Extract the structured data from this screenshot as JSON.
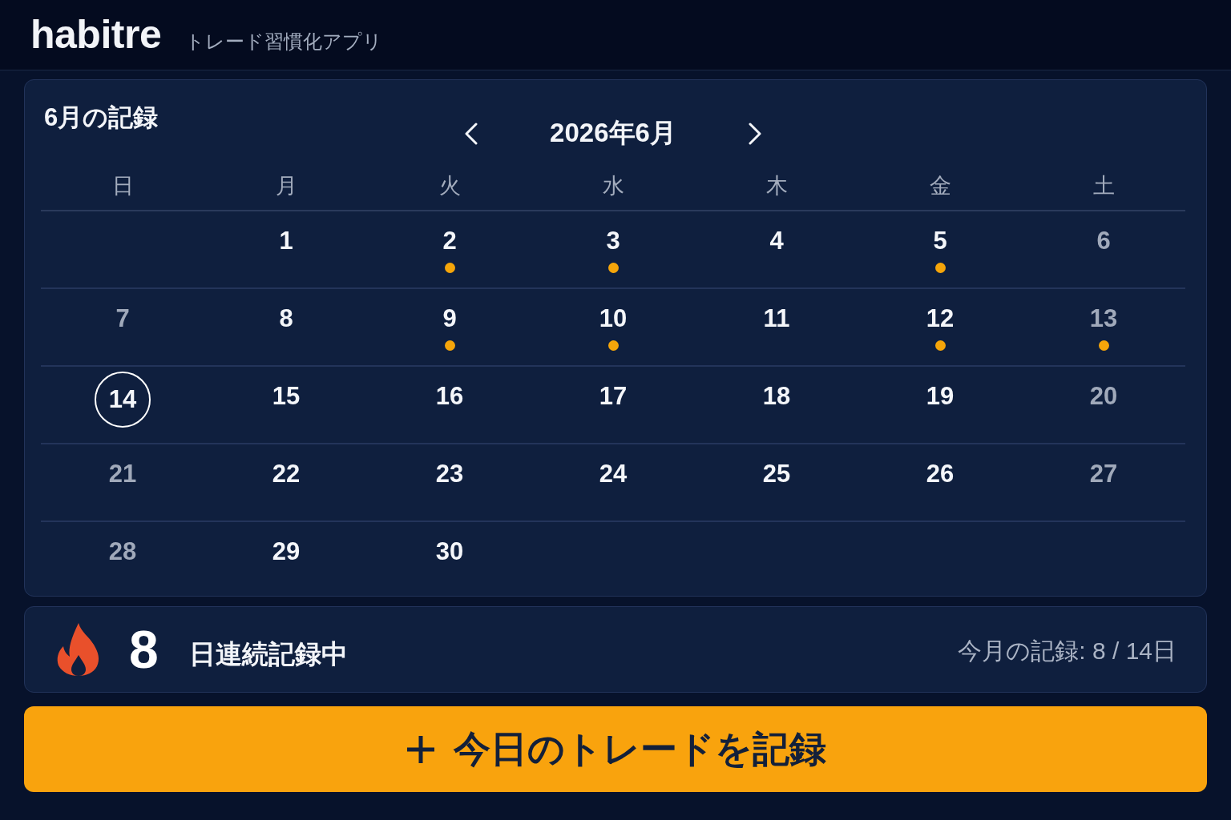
{
  "header": {
    "app_name": "habitre",
    "tagline": "トレード習慣化アプリ"
  },
  "calendar": {
    "title": "6月の記録",
    "month_label": "2026年6月",
    "weekdays": [
      "日",
      "月",
      "火",
      "水",
      "木",
      "金",
      "土"
    ],
    "weeks": [
      {
        "days": [
          {
            "kind": "blank"
          },
          {
            "kind": "day",
            "label": "1",
            "weekend": false,
            "recorded": false,
            "selected": false
          },
          {
            "kind": "day",
            "label": "2",
            "weekend": false,
            "recorded": true,
            "selected": false
          },
          {
            "kind": "day",
            "label": "3",
            "weekend": false,
            "recorded": true,
            "selected": false
          },
          {
            "kind": "day",
            "label": "4",
            "weekend": false,
            "recorded": false,
            "selected": false
          },
          {
            "kind": "day",
            "label": "5",
            "weekend": false,
            "recorded": true,
            "selected": false
          },
          {
            "kind": "day",
            "label": "6",
            "weekend": true,
            "recorded": false,
            "selected": false
          }
        ]
      },
      {
        "days": [
          {
            "kind": "day",
            "label": "7",
            "weekend": true,
            "recorded": false,
            "selected": false
          },
          {
            "kind": "day",
            "label": "8",
            "weekend": false,
            "recorded": false,
            "selected": false
          },
          {
            "kind": "day",
            "label": "9",
            "weekend": false,
            "recorded": true,
            "selected": false
          },
          {
            "kind": "day",
            "label": "10",
            "weekend": false,
            "recorded": true,
            "selected": false
          },
          {
            "kind": "day",
            "label": "11",
            "weekend": false,
            "recorded": false,
            "selected": false
          },
          {
            "kind": "day",
            "label": "12",
            "weekend": false,
            "recorded": true,
            "selected": false
          },
          {
            "kind": "day",
            "label": "13",
            "weekend": true,
            "recorded": true,
            "selected": false
          }
        ]
      },
      {
        "days": [
          {
            "kind": "day",
            "label": "14",
            "weekend": true,
            "recorded": false,
            "selected": true
          },
          {
            "kind": "day",
            "label": "15",
            "weekend": false,
            "recorded": false,
            "selected": false
          },
          {
            "kind": "day",
            "label": "16",
            "weekend": false,
            "recorded": false,
            "selected": false
          },
          {
            "kind": "day",
            "label": "17",
            "weekend": false,
            "recorded": false,
            "selected": false
          },
          {
            "kind": "day",
            "label": "18",
            "weekend": false,
            "recorded": false,
            "selected": false
          },
          {
            "kind": "day",
            "label": "19",
            "weekend": false,
            "recorded": false,
            "selected": false
          },
          {
            "kind": "day",
            "label": "20",
            "weekend": true,
            "recorded": false,
            "selected": false
          }
        ]
      },
      {
        "days": [
          {
            "kind": "day",
            "label": "21",
            "weekend": true,
            "recorded": false,
            "selected": false
          },
          {
            "kind": "day",
            "label": "22",
            "weekend": false,
            "recorded": false,
            "selected": false
          },
          {
            "kind": "day",
            "label": "23",
            "weekend": false,
            "recorded": false,
            "selected": false
          },
          {
            "kind": "day",
            "label": "24",
            "weekend": false,
            "recorded": false,
            "selected": false
          },
          {
            "kind": "day",
            "label": "25",
            "weekend": false,
            "recorded": false,
            "selected": false
          },
          {
            "kind": "day",
            "label": "26",
            "weekend": false,
            "recorded": false,
            "selected": false
          },
          {
            "kind": "day",
            "label": "27",
            "weekend": true,
            "recorded": false,
            "selected": false
          }
        ]
      },
      {
        "days": [
          {
            "kind": "day",
            "label": "28",
            "weekend": true,
            "recorded": false,
            "selected": false
          },
          {
            "kind": "day",
            "label": "29",
            "weekend": false,
            "recorded": false,
            "selected": false
          },
          {
            "kind": "day",
            "label": "30",
            "weekend": false,
            "recorded": false,
            "selected": false
          }
        ]
      }
    ]
  },
  "streak": {
    "count": "8",
    "label": "日連続記録中",
    "month_summary": "今月の記録: 8 / 14日"
  },
  "record_button": {
    "label": "今日のトレードを記録"
  }
}
